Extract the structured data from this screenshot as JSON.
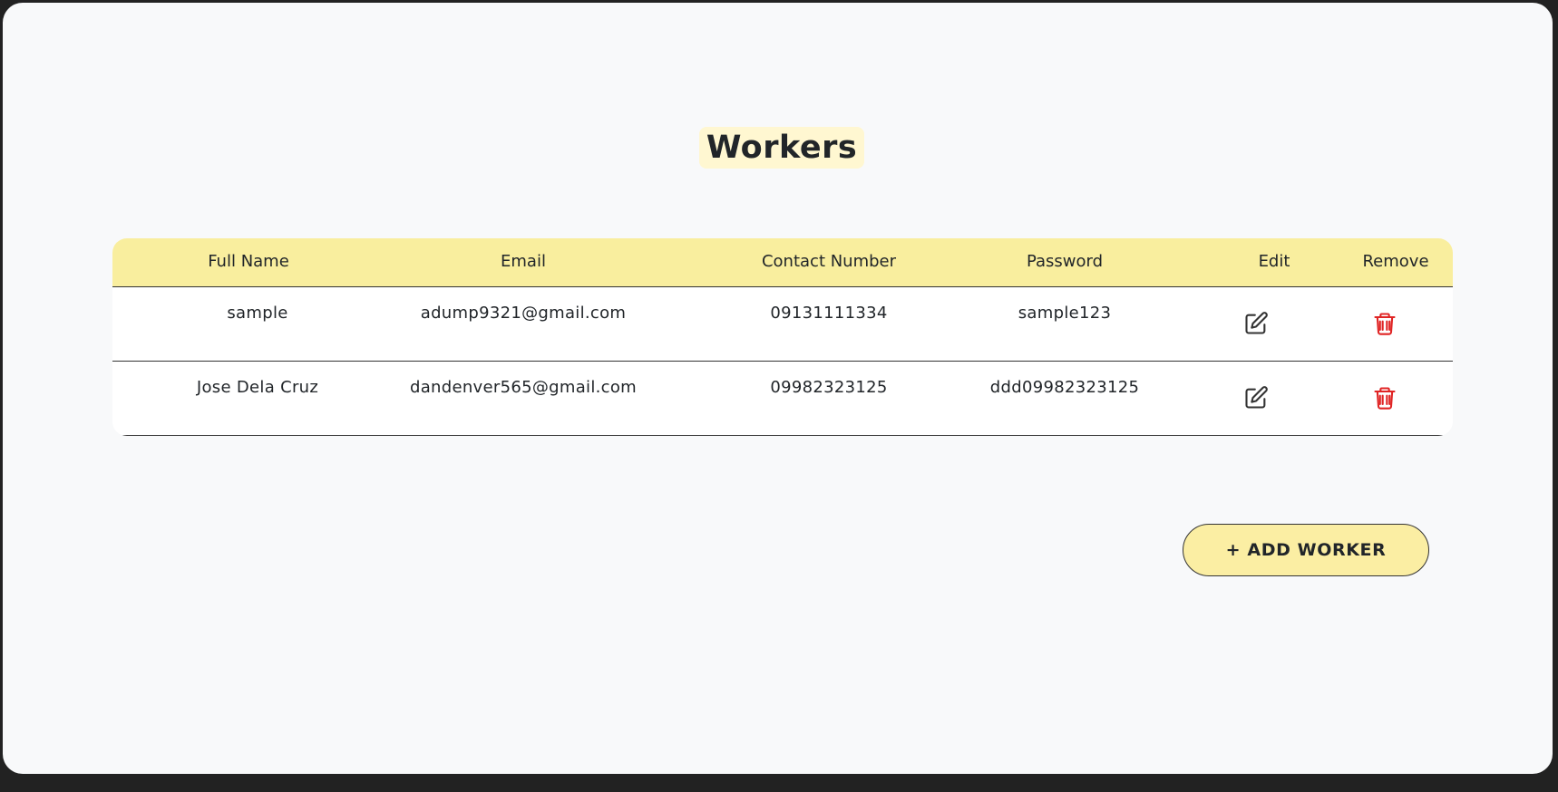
{
  "page": {
    "title": "Workers"
  },
  "table": {
    "headers": {
      "full_name": "Full Name",
      "email": "Email",
      "contact": "Contact Number",
      "password": "Password",
      "edit": "Edit",
      "remove": "Remove"
    },
    "rows": [
      {
        "full_name": "sample",
        "email": "adump9321@gmail.com",
        "contact": "09131111334",
        "password": "sample123"
      },
      {
        "full_name": "Jose Dela Cruz",
        "email": "dandenver565@gmail.com",
        "contact": "09982323125",
        "password": "ddd09982323125"
      }
    ],
    "edit_icon": "pencil-square-icon",
    "remove_icon": "trash-icon"
  },
  "actions": {
    "add_worker_label": "+ ADD WORKER"
  },
  "colors": {
    "header_bg": "#f9ee9e",
    "button_bg": "#fbeea3",
    "title_highlight": "#fff7d1",
    "remove_red": "#e02424"
  }
}
